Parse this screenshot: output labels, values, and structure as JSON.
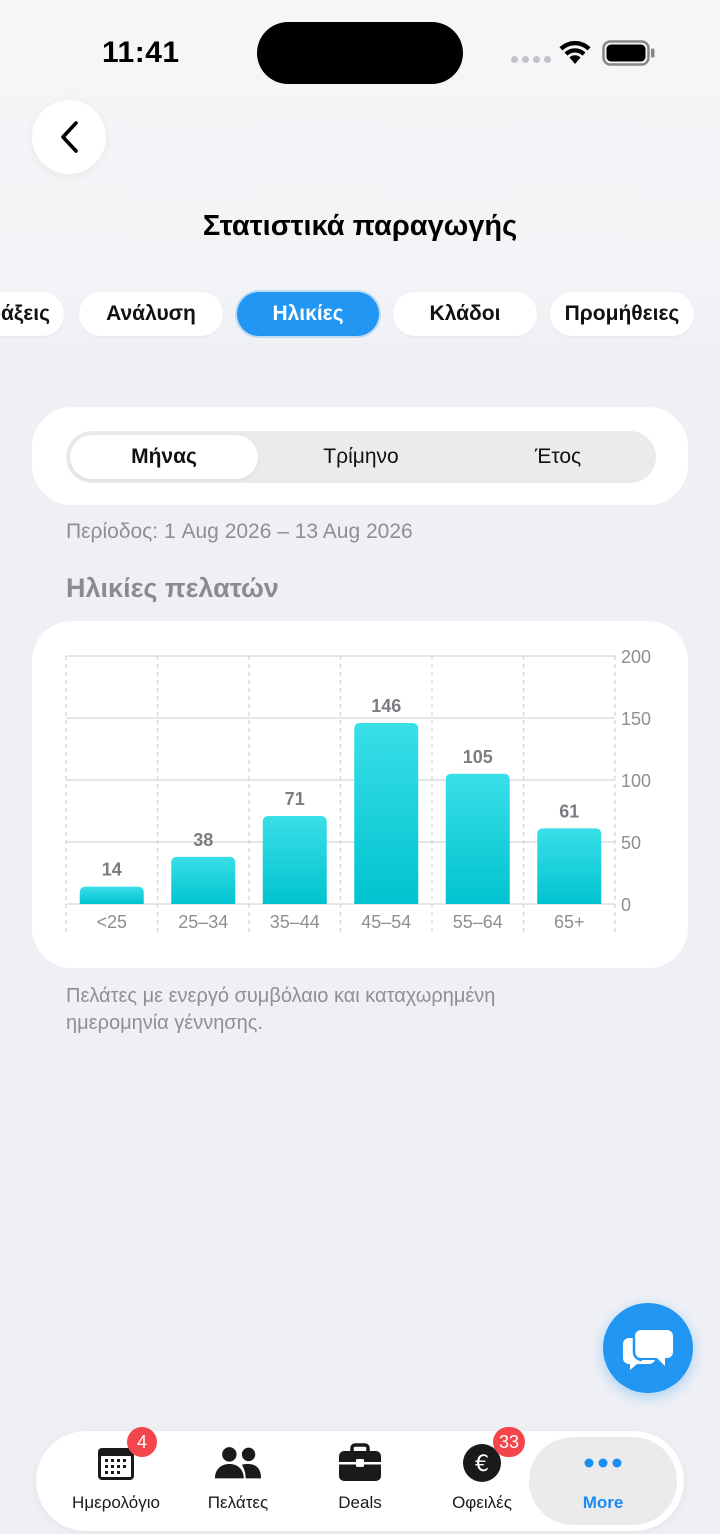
{
  "status": {
    "time": "11:41"
  },
  "header": {
    "title": "Στατιστικά παραγωγής"
  },
  "tabs": [
    {
      "label": "Πράξεις",
      "active": false
    },
    {
      "label": "Ανάλυση",
      "active": false
    },
    {
      "label": "Ηλικίες",
      "active": true
    },
    {
      "label": "Κλάδοι",
      "active": false
    },
    {
      "label": "Προμήθειες",
      "active": false
    }
  ],
  "segmented": {
    "options": [
      "Μήνας",
      "Τρίμηνο",
      "Έτος"
    ],
    "selected": "Μήνας"
  },
  "period": "Περίοδος: 1 Aug 2026 – 13 Aug 2026",
  "section_title": "Ηλικίες πελατών",
  "chart_data": {
    "type": "bar",
    "categories": [
      "<25",
      "25–34",
      "35–44",
      "45–54",
      "55–64",
      "65+"
    ],
    "values": [
      14,
      38,
      71,
      146,
      105,
      61
    ],
    "ylim": [
      0,
      200
    ],
    "yticks": [
      0,
      50,
      100,
      150,
      200
    ],
    "y_axis_side": "right",
    "grid": true,
    "bar_color_top": "#3adfe8",
    "bar_color_bottom": "#00c3cf",
    "title": "",
    "xlabel": "",
    "ylabel": ""
  },
  "footnote": "Πελάτες με ενεργό συμβόλαιο και καταχωρημένη ημερομηνία γέννησης.",
  "nav": [
    {
      "label": "Ημερολόγιο",
      "icon": "calendar-icon",
      "badge": "4",
      "active": false
    },
    {
      "label": "Πελάτες",
      "icon": "people-icon",
      "badge": null,
      "active": false
    },
    {
      "label": "Deals",
      "icon": "briefcase-icon",
      "badge": null,
      "active": false
    },
    {
      "label": "Οφειλές",
      "icon": "euro-icon",
      "badge": "33",
      "active": false
    },
    {
      "label": "More",
      "icon": "more-dots-icon",
      "badge": null,
      "active": true
    }
  ],
  "colors": {
    "accent": "#2196f3",
    "badge": "#f2464c",
    "background": "#eff0f5"
  }
}
